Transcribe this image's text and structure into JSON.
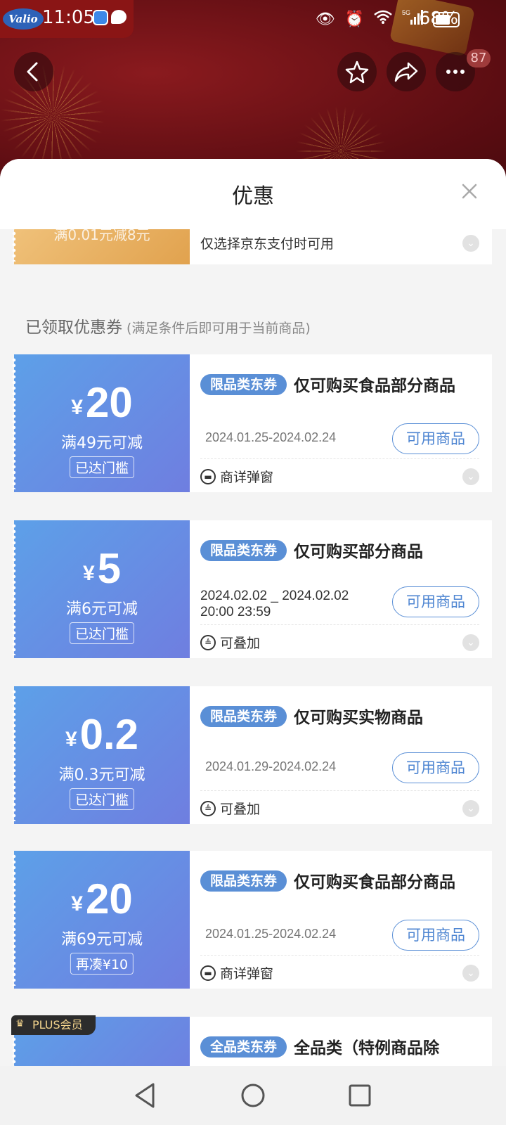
{
  "status_bar": {
    "brand": "Valio",
    "time": "11:05",
    "signal": "5G",
    "battery": "68%"
  },
  "header": {
    "more_badge": "87"
  },
  "sheet": {
    "title": "优惠",
    "close": "×",
    "partial_card": {
      "cond": "满0.01元减8元",
      "desc": "仅选择京东支付时可用"
    },
    "section": {
      "title": "已领取优惠券",
      "subtitle": "(满足条件后即可用于当前商品)"
    },
    "coupons": [
      {
        "currency": "¥",
        "amount": "20",
        "cond": "满49元可减",
        "threshold": "已达门槛",
        "type": "限品类东券",
        "title": "仅可购买食品部分商品",
        "date": "2024.01.25-2024.02.24",
        "button": "可用商品",
        "footer": "商详弹窗"
      },
      {
        "currency": "¥",
        "amount": "5",
        "cond": "满6元可减",
        "threshold": "已达门槛",
        "type": "限品类东券",
        "title": "仅可购买部分商品",
        "date_line1": "2024.02.02 _ 2024.02.02",
        "date_line2": "20:00 23:59",
        "button": "可用商品",
        "footer": "可叠加"
      },
      {
        "currency": "¥",
        "amount": "0.2",
        "cond": "满0.3元可减",
        "threshold": "已达门槛",
        "type": "限品类东券",
        "title": "仅可购买实物商品",
        "date": "2024.01.29-2024.02.24",
        "button": "可用商品",
        "footer": "可叠加"
      },
      {
        "currency": "¥",
        "amount": "20",
        "cond": "满69元可减",
        "threshold": "再凑¥10",
        "type": "限品类东券",
        "title": "仅可购买食品部分商品",
        "date": "2024.01.25-2024.02.24",
        "button": "可用商品",
        "footer": "商详弹窗"
      }
    ],
    "plus_card": {
      "badge": "PLUS会员",
      "type": "全品类东券",
      "title": "全品类（特例商品除"
    }
  },
  "icons": {
    "back": "chevron-left-icon",
    "favorite": "star-icon",
    "share": "share-icon",
    "more": "more-icon",
    "close": "close-icon",
    "popup": "popup-icon",
    "stack": "stack-icon",
    "expand": "chevron-down-icon"
  },
  "colors": {
    "coupon_gradient_start": "#5da0e8",
    "coupon_gradient_end": "#6f7ee0",
    "pill": "#5a8fd6",
    "header_bg": "#6e1414"
  }
}
